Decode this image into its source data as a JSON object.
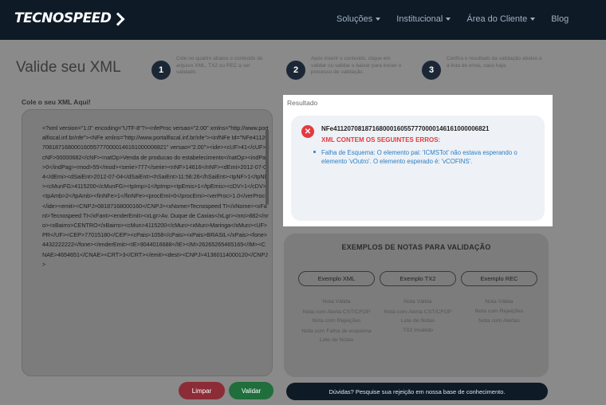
{
  "nav": {
    "logo": "TECNOSPEED",
    "menu": [
      "Soluções",
      "Institucional",
      "Área do Cliente",
      "Blog"
    ]
  },
  "page": {
    "title": "Valide seu XML",
    "steps": [
      {
        "num": "1",
        "text": "Cole no quadro abaixo o conteúdo do arquivo XML, TX2 ou REC a ser validado."
      },
      {
        "num": "2",
        "text": "Após inserir o conteúdo, clique em validar ou validar e baixar para iniciar o processo de validação."
      },
      {
        "num": "3",
        "text": "Confira o resultado da validação abaixo e a lista de erros, caso haja."
      }
    ]
  },
  "xml": {
    "label": "Cole o seu XML Aqui!",
    "content": "<?xml version=\"1.0\" encoding=\"UTF-8\"?><nfeProc versao=\"2.00\" xmlns=\"http://www.portalfiscal.inf.br/nfe\"><NFe xmlns=\"http://www.portalfiscal.inf.br/nfe\"><infNFe Id=\"NFe41120708187168000160557770000146161000006821\" versao=\"2.00\"><ide><cUF>41</cUF><cNF>00000682</cNF><natOp>Venda de producao do estabelecimento</natOp><indPag>0</indPag><mod>55</mod><serie>777</serie><nNF>14616</nNF><dEmi>2012-07-04</dEmi><dSaiEnt>2012-07-04</dSaiEnt><hSaiEnt>11:56:26</hSaiEnt><tpNF>1</tpNF><cMunFG>4115200</cMunFG><tpImp>1</tpImp><tpEmis>1</tpEmis><cDV>1</cDV><tpAmb>2</tpAmb><finNFe>1</finNFe><procEmi>0</procEmi><verProc>1.0</verProc></ide><emit><CNPJ>08187168000160</CNPJ><xNome>Tecnospeed TI</xNome><xFant>Tecnospeed TI</xFant><enderEmit><xLgr>Av. Duque de Caxias</xLgr><nro>882</nro><xBairro>CENTRO</xBairro><cMun>4115200</cMun><xMun>Maringa</xMun><UF>PR</UF><CEP>77015180</CEP><cPais>1058</cPais><xPais>BRASIL</xPais><fone>4432222222</fone></enderEmit><IE>9044016688</IE><IM>26265265465165</IM><CNAE>4654651</CNAE><CRT>3</CRT></emit><dest><CNPJ>41360114000120</CNPJ>",
    "clear_label": "Limpar",
    "validate_label": "Validar"
  },
  "result": {
    "label": "Resultado",
    "key": "NFe41120708187168000160557770000146161000006821",
    "heading": "XML CONTEM OS SEGUINTES ERROS:",
    "message": "Falha de Esquema: O elemento pai: 'ICMSTot' não estava esperando o elemento 'vOutro'. O elemento esperado é: 'vCOFINS'.",
    "error_color": "#e23a3f",
    "link_color": "#2a7fc6"
  },
  "examples": {
    "title": "EXEMPLOS DE NOTAS PARA VALIDAÇÃO",
    "columns": [
      {
        "button": "Exemplo XML",
        "items": [
          "Nota Válida",
          "Nota com Alerta CST/CFOP",
          "Nota com Rejeições",
          "Nota com Falha de esquema",
          "Lote de Notas"
        ]
      },
      {
        "button": "Exemplo TX2",
        "items": [
          "Nota Válida",
          "Nota com Alerta CST/CFOP",
          "Lote de Notas",
          "TX2 Inválido"
        ]
      },
      {
        "button": "Exemplo REC",
        "items": [
          "Nota Válida",
          "Nota com Rejeições",
          "Nota com Alertas"
        ]
      }
    ]
  },
  "help": {
    "text": "Dúvidas? Pesquise sua rejeição em nossa base de conhecimento."
  }
}
